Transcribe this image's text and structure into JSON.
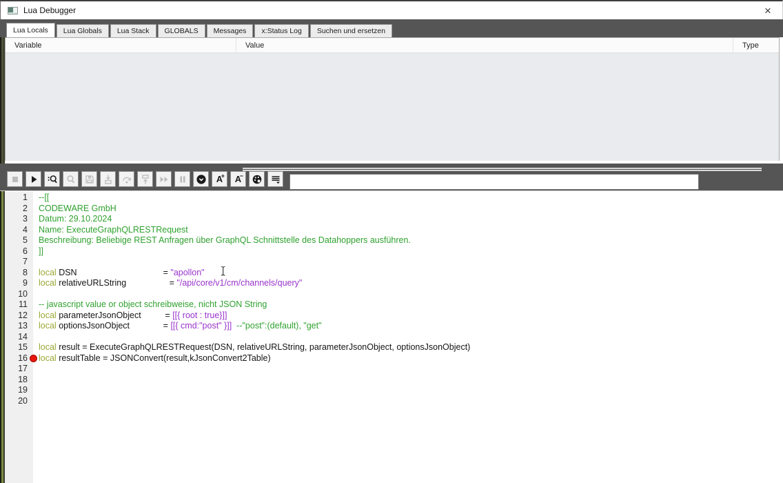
{
  "window": {
    "title": "Lua Debugger",
    "close_glyph": "×"
  },
  "tabs": [
    {
      "label": "Lua Locals",
      "active": true
    },
    {
      "label": "Lua Globals",
      "active": false
    },
    {
      "label": "Lua Stack",
      "active": false
    },
    {
      "label": "GLOBALS",
      "active": false
    },
    {
      "label": "Messages",
      "active": false
    },
    {
      "label": "x:Status Log",
      "active": false
    },
    {
      "label": "Suchen und ersetzen",
      "active": false
    }
  ],
  "variables_table": {
    "columns": [
      "Variable",
      "Value",
      "Type"
    ],
    "rows": []
  },
  "toolbar": {
    "buttons": [
      {
        "name": "stop",
        "enabled": false
      },
      {
        "name": "run",
        "enabled": true
      },
      {
        "name": "find",
        "enabled": true
      },
      {
        "name": "zoom",
        "enabled": false
      },
      {
        "name": "save",
        "enabled": false
      },
      {
        "name": "step-into",
        "enabled": false
      },
      {
        "name": "step-over",
        "enabled": false
      },
      {
        "name": "step-out",
        "enabled": false
      },
      {
        "name": "run-to-cursor",
        "enabled": false
      },
      {
        "name": "pause",
        "enabled": false
      },
      {
        "name": "toggle-breakpoint",
        "enabled": true
      },
      {
        "name": "font-increase",
        "enabled": true,
        "label": "A",
        "sub": "+"
      },
      {
        "name": "font-decrease",
        "enabled": true,
        "label": "A",
        "sub": "−"
      },
      {
        "name": "colors",
        "enabled": true
      },
      {
        "name": "line-options",
        "enabled": true
      }
    ],
    "search_value": ""
  },
  "editor": {
    "breakpoint_line": 16,
    "colors": {
      "keyword": "#9ba835",
      "comment": "#2fa12f",
      "string": "#9933cc",
      "default": "#141414"
    },
    "lines": [
      {
        "num": 1,
        "tokens": [
          {
            "c": "c",
            "t": "--[["
          }
        ]
      },
      {
        "num": 2,
        "tokens": [
          {
            "c": "c",
            "t": "CODEWARE GmbH"
          }
        ]
      },
      {
        "num": 3,
        "tokens": [
          {
            "c": "c",
            "t": "Datum: 29.10.2024"
          }
        ]
      },
      {
        "num": 4,
        "tokens": [
          {
            "c": "c",
            "t": "Name: ExecuteGraphQLRESTRequest"
          }
        ]
      },
      {
        "num": 5,
        "tokens": [
          {
            "c": "c",
            "t": "Beschreibung: Beliebige REST Anfragen über GraphQL Schnittstelle des Datahoppers ausführen."
          }
        ]
      },
      {
        "num": 6,
        "tokens": [
          {
            "c": "c",
            "t": "]]"
          }
        ]
      },
      {
        "num": 7,
        "tokens": []
      },
      {
        "num": 8,
        "tokens": [
          {
            "c": "k",
            "t": "local"
          },
          {
            "c": "d",
            "t": " DSN                                    = "
          },
          {
            "c": "s",
            "t": "\"apollon\""
          }
        ]
      },
      {
        "num": 9,
        "tokens": [
          {
            "c": "k",
            "t": "local"
          },
          {
            "c": "d",
            "t": " relativeURLString                  = "
          },
          {
            "c": "s",
            "t": "\"/api/core/v1/cm/channels/query\""
          }
        ]
      },
      {
        "num": 10,
        "tokens": []
      },
      {
        "num": 11,
        "tokens": [
          {
            "c": "c",
            "t": "-- javascript value or object schreibweise, nicht JSON String"
          }
        ]
      },
      {
        "num": 12,
        "tokens": [
          {
            "c": "k",
            "t": "local"
          },
          {
            "c": "d",
            "t": " parameterJsonObject          = "
          },
          {
            "c": "s",
            "t": "[[{ root : true}]]"
          }
        ]
      },
      {
        "num": 13,
        "tokens": [
          {
            "c": "k",
            "t": "local"
          },
          {
            "c": "d",
            "t": " optionsJsonObject              = "
          },
          {
            "c": "s",
            "t": "[[{ cmd:\"post\" }]]"
          },
          {
            "c": "d",
            "t": "  "
          },
          {
            "c": "c",
            "t": "--\"post\":(default), \"get\""
          }
        ]
      },
      {
        "num": 14,
        "tokens": []
      },
      {
        "num": 15,
        "tokens": [
          {
            "c": "k",
            "t": "local"
          },
          {
            "c": "d",
            "t": " result = ExecuteGraphQLRESTRequest(DSN, relativeURLString, parameterJsonObject, optionsJsonObject)"
          }
        ]
      },
      {
        "num": 16,
        "tokens": [
          {
            "c": "k",
            "t": "local"
          },
          {
            "c": "d",
            "t": " resultTable = JSONConvert(result,kJsonConvert2Table)"
          }
        ]
      },
      {
        "num": 17,
        "tokens": []
      },
      {
        "num": 18,
        "tokens": []
      },
      {
        "num": 19,
        "tokens": []
      },
      {
        "num": 20,
        "tokens": []
      }
    ]
  }
}
